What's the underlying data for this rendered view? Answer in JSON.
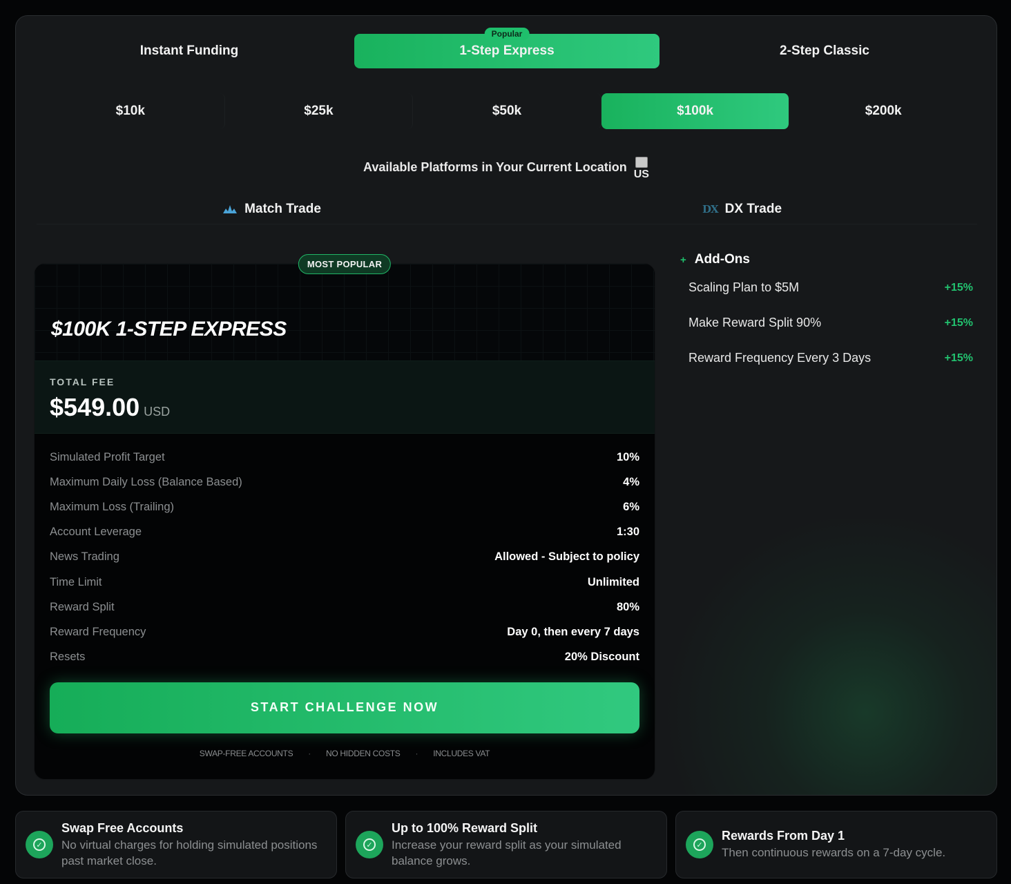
{
  "program_tabs": [
    {
      "label": "Instant Funding"
    },
    {
      "label": "1-Step Express",
      "badge": "Popular"
    },
    {
      "label": "2-Step Classic"
    }
  ],
  "sizes": [
    "$10k",
    "$25k",
    "$50k",
    "$100k",
    "$200k"
  ],
  "active_size": "$100k",
  "location": {
    "text": "Available Platforms in Your Current Location",
    "flag_code": "US"
  },
  "platforms": [
    {
      "label": "Match Trade",
      "icon": "match-trade-logo-icon"
    },
    {
      "label": "DX Trade",
      "icon": "dx-trade-logo-icon",
      "icon_text": "DX"
    }
  ],
  "plan": {
    "badge": "MOST POPULAR",
    "title": "$100K 1-STEP EXPRESS",
    "fee_label": "TOTAL FEE",
    "fee_amount": "$549.00",
    "fee_currency": "USD",
    "specs": [
      {
        "label": "Simulated Profit Target",
        "value": "10%"
      },
      {
        "label": "Maximum Daily Loss (Balance Based)",
        "value": "4%"
      },
      {
        "label": "Maximum Loss (Trailing)",
        "value": "6%"
      },
      {
        "label": "Account Leverage",
        "value": "1:30"
      },
      {
        "label": "News Trading",
        "value": "Allowed - Subject to policy"
      },
      {
        "label": "Time Limit",
        "value": "Unlimited"
      },
      {
        "label": "Reward Split",
        "value": "80%"
      },
      {
        "label": "Reward Frequency",
        "value": "Day 0, then every 7 days"
      },
      {
        "label": "Resets",
        "value": "20% Discount"
      }
    ],
    "cta": "START CHALLENGE NOW",
    "perks": [
      "SWAP-FREE ACCOUNTS",
      "NO HIDDEN COSTS",
      "INCLUDES VAT"
    ]
  },
  "addons": {
    "title": "Add-Ons",
    "items": [
      {
        "label": "Scaling Plan to $5M",
        "price": "+15%"
      },
      {
        "label": "Make Reward Split 90%",
        "price": "+15%"
      },
      {
        "label": "Reward Frequency Every 3 Days",
        "price": "+15%"
      }
    ]
  },
  "features": [
    {
      "title": "Swap Free Accounts",
      "desc": "No virtual charges for holding simulated positions past market close."
    },
    {
      "title": "Up to 100% Reward Split",
      "desc": "Increase your reward split as your simulated balance grows."
    },
    {
      "title": "Rewards From Day 1",
      "desc": "Then continuous rewards on a 7-day cycle."
    }
  ],
  "colors": {
    "accent": "#1fbf6c",
    "panel": "#16181a",
    "card": "#030405"
  }
}
